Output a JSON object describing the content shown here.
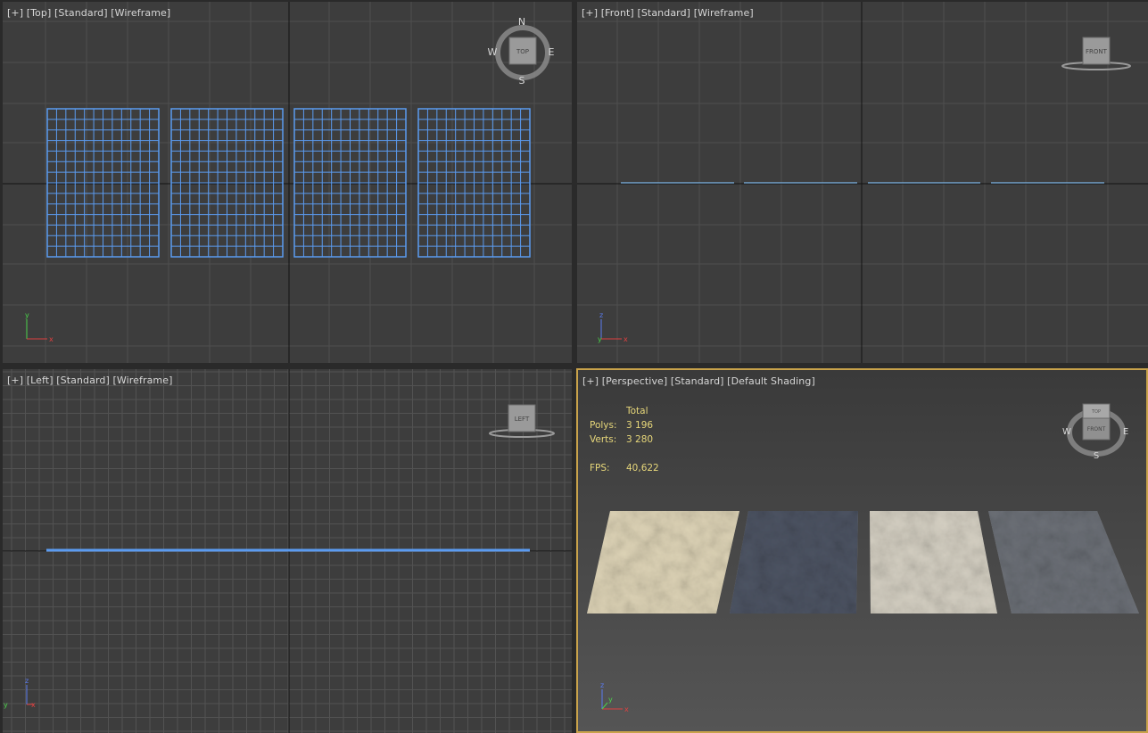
{
  "viewports": {
    "top": {
      "label_plus": "[+]",
      "label_view": "[Top]",
      "label_mode": "[Standard]",
      "label_shade": "[Wireframe]",
      "viewcube": "TOP",
      "compass": {
        "n": "N",
        "s": "S",
        "e": "E",
        "w": "W"
      },
      "axes": {
        "a": "y",
        "b": "x"
      }
    },
    "front": {
      "label_plus": "[+]",
      "label_view": "[Front]",
      "label_mode": "[Standard]",
      "label_shade": "[Wireframe]",
      "viewcube": "FRONT",
      "axes": {
        "a": "z",
        "b": "x",
        "c": "y"
      }
    },
    "left": {
      "label_plus": "[+]",
      "label_view": "[Left]",
      "label_mode": "[Standard]",
      "label_shade": "[Wireframe]",
      "viewcube": "LEFT",
      "axes": {
        "a": "z",
        "b": "x",
        "c": "y"
      }
    },
    "perspective": {
      "label_plus": "[+]",
      "label_view": "[Perspective]",
      "label_mode": "[Standard]",
      "label_shade": "[Default Shading]",
      "viewcube_top": "TOP",
      "viewcube_front": "FRONT",
      "compass": {
        "w": "W",
        "e": "E",
        "s": "S"
      },
      "axes": {
        "a": "z",
        "b": "x",
        "c": "y"
      },
      "stats": {
        "total_header": "Total",
        "polys_label": "Polys:",
        "polys_value": "3 196",
        "verts_label": "Verts:",
        "verts_value": "3 280",
        "fps_label": "FPS:",
        "fps_value": "40,622"
      }
    }
  },
  "colors": {
    "selection_blue": "#5b9bf0",
    "active_border": "#c8a24a",
    "stats_yellow": "#e7d77a",
    "rug_colors": [
      "#ddd3b6",
      "#4d5463",
      "#d4cfc2",
      "#6c7077"
    ]
  }
}
